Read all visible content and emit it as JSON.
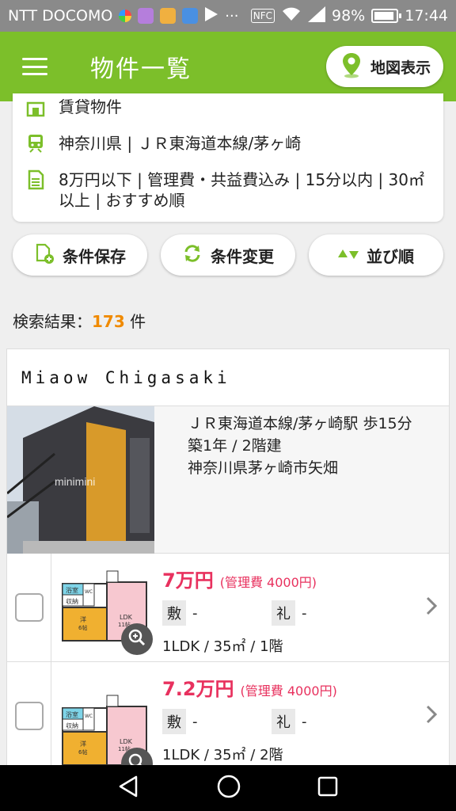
{
  "status_bar": {
    "carrier": "NTT DOCOMO",
    "battery": "98%",
    "time": "17:44",
    "nfc": "NFC"
  },
  "app_bar": {
    "title": "物件一覧",
    "map_button": "地図表示"
  },
  "conditions": {
    "type": "賃貸物件",
    "line": "神奈川県 | ＪＲ東海道本線/茅ヶ崎",
    "details": "8万円以下 | 管理費・共益費込み | 15分以内 | 30㎡以上 | おすすめ順"
  },
  "actions": {
    "save": "条件保存",
    "change": "条件変更",
    "sort": "並び順"
  },
  "results": {
    "label": "検索結果：",
    "count": "173",
    "unit": "件"
  },
  "listing": {
    "title": "Miaow Chigasaki",
    "access": "ＪＲ東海道本線/茅ヶ崎駅 歩15分",
    "age": "築1年 / 2階建",
    "address": "神奈川県茅ヶ崎市矢畑",
    "photo_watermark": "minimini",
    "rooms": [
      {
        "price": "7万円",
        "mgmt": "(管理費 4000円)",
        "deposit_label": "敷",
        "deposit": "-",
        "key_label": "礼",
        "key": "-",
        "layout": "1LDK / 35㎡ / 1階"
      },
      {
        "price": "7.2万円",
        "mgmt": "(管理費 4000円)",
        "deposit_label": "敷",
        "deposit": "-",
        "key_label": "礼",
        "key": "-",
        "layout": "1LDK / 35㎡ / 2階"
      }
    ],
    "floor_plan_labels": {
      "bath": "浴室",
      "storage": "収納",
      "washroom": "WC",
      "western": "洋",
      "size_a": "6帖",
      "ldk": "LDK",
      "size_b": "11帖"
    }
  },
  "colors": {
    "brand": "#7cbf2a",
    "price": "#e8315e",
    "count": "#f08a00"
  }
}
